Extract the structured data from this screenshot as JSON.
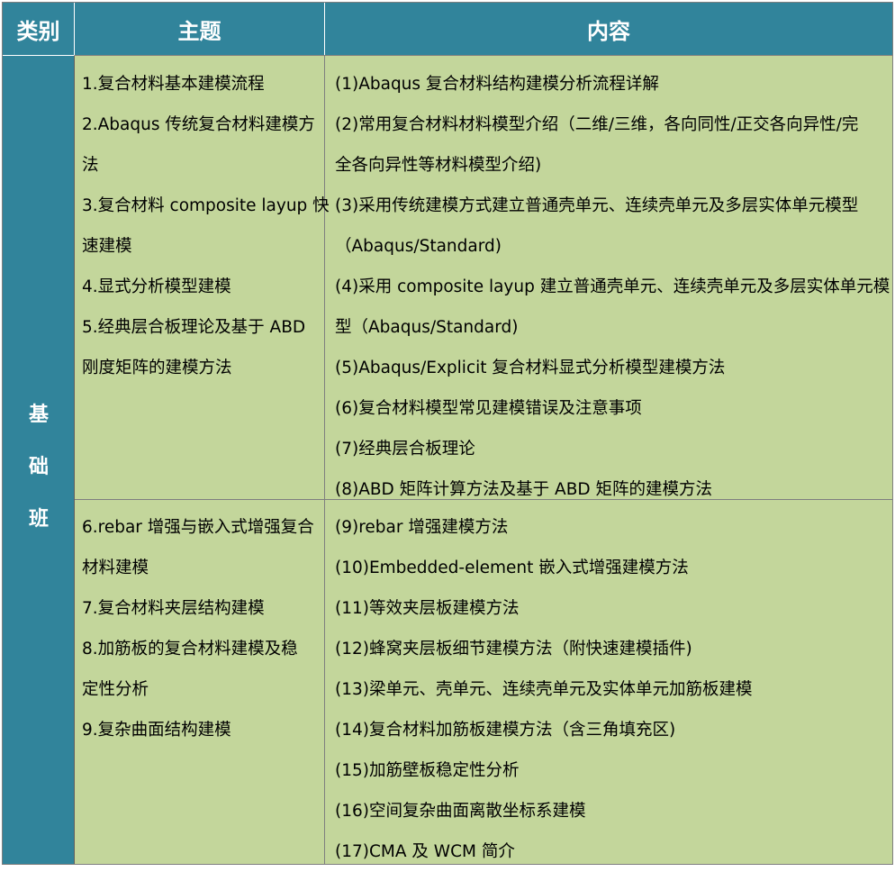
{
  "header": {
    "category": "类别",
    "topic": "主题",
    "content": "内容"
  },
  "category": {
    "chars": [
      "基",
      "础",
      "班"
    ]
  },
  "section1": {
    "topic_lines": [
      "1.复合材料基本建模流程",
      "2.Abaqus 传统复合材料建模方",
      "法",
      "3.复合材料 composite layup 快",
      "速建模",
      "4.显式分析模型建模",
      "5.经典层合板理论及基于 ABD",
      "刚度矩阵的建模方法"
    ],
    "content_lines": [
      "(1)Abaqus 复合材料结构建模分析流程详解",
      "(2)常用复合材料材料模型介绍（二维/三维，各向同性/正交各向异性/完",
      "全各向异性等材料模型介绍)",
      "(3)采用传统建模方式建立普通壳单元、连续壳单元及多层实体单元模型",
      "（Abaqus/Standard)",
      "(4)采用 composite layup 建立普通壳单元、连续壳单元及多层实体单元模",
      "型（Abaqus/Standard)",
      "(5)Abaqus/Explicit 复合材料显式分析模型建模方法",
      "(6)复合材料模型常见建模错误及注意事项",
      "(7)经典层合板理论",
      "(8)ABD 矩阵计算方法及基于 ABD 矩阵的建模方法"
    ]
  },
  "section2": {
    "topic_lines": [
      "6.rebar 增强与嵌入式增强复合",
      "材料建模",
      "7.复合材料夹层结构建模",
      "8.加筋板的复合材料建模及稳",
      "定性分析",
      "9.复杂曲面结构建模"
    ],
    "content_lines": [
      "(9)rebar 增强建模方法",
      "(10)Embedded-element 嵌入式增强建模方法",
      "(11)等效夹层板建模方法",
      "(12)蜂窝夹层板细节建模方法（附快速建模插件)",
      "(13)梁单元、壳单元、连续壳单元及实体单元加筋板建模",
      "(14)复合材料加筋板建模方法（含三角填充区)",
      "(15)加筋壁板稳定性分析",
      "(16)空间复杂曲面离散坐标系建模",
      "(17)CMA 及 WCM 简介"
    ]
  }
}
